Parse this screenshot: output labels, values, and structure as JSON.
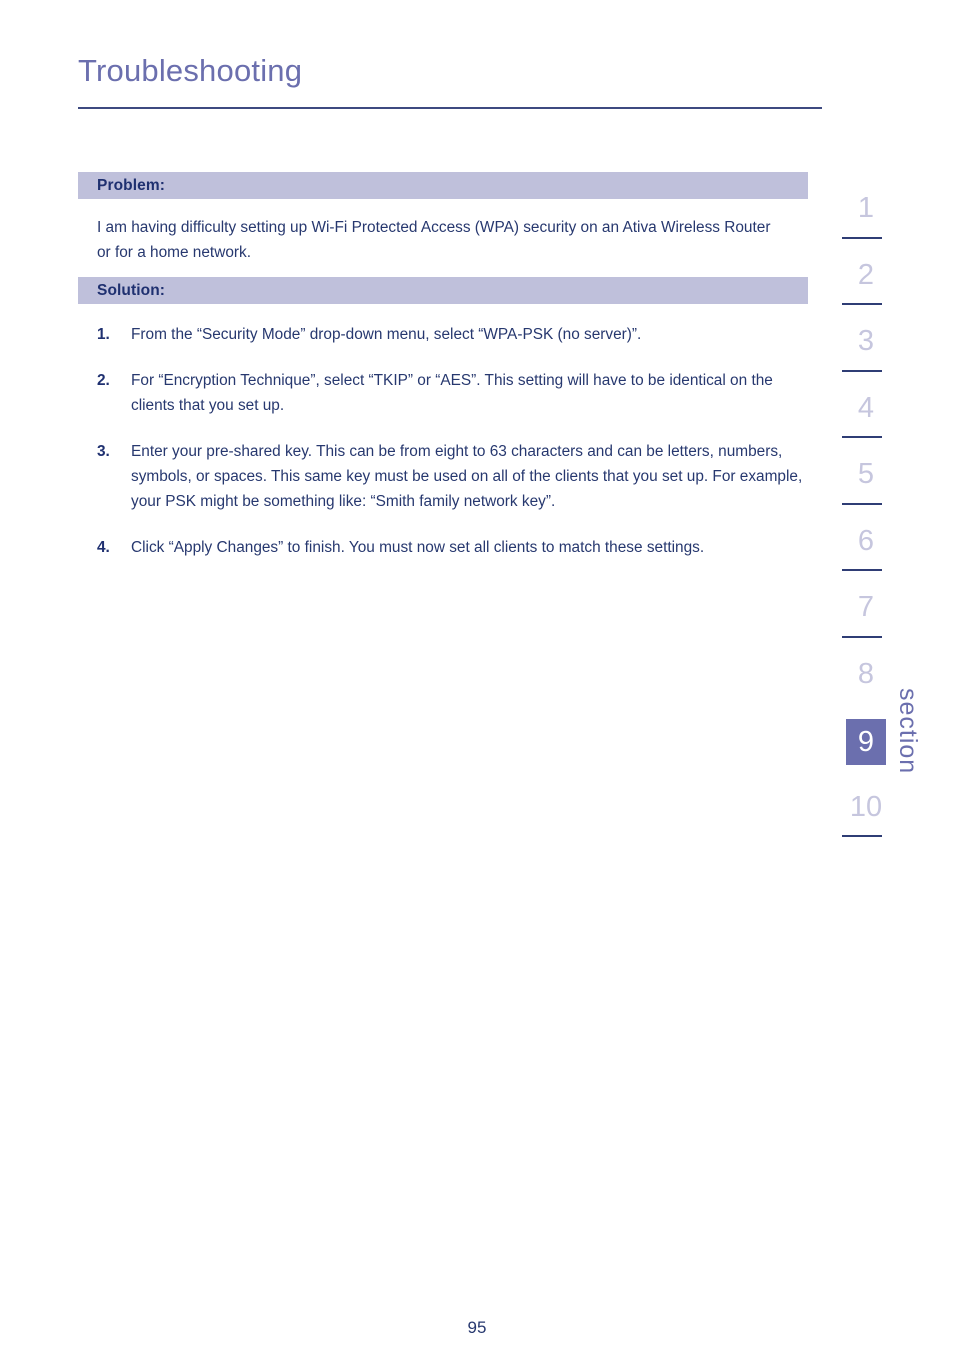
{
  "page": {
    "title": "Troubleshooting",
    "number": "95"
  },
  "colors": {
    "title": "#6b6fae",
    "band_background": "#bfc0db",
    "band_text": "#1f3070",
    "body_text": "#27386f",
    "rail_inactive": "#c6c6de",
    "rail_active_background": "#6b6fae",
    "rail_divider": "#2f3d75"
  },
  "problem": {
    "label": "Problem:",
    "text": "I am having difficulty setting up Wi-Fi Protected Access (WPA) security on an Ativa Wireless Router or for a home network."
  },
  "solution": {
    "label": "Solution:",
    "steps": [
      {
        "number": "1.",
        "text": "From the “Security Mode” drop-down menu, select “WPA-PSK (no server)”."
      },
      {
        "number": "2.",
        "text": "For “Encryption Technique”, select “TKIP” or “AES”. This setting will have to be identical on the clients that you set up."
      },
      {
        "number": "3.",
        "text": "Enter your pre-shared key. This can be from eight to 63 characters and can be letters, numbers, symbols, or spaces. This same key must be used on all of the clients that you set up. For example, your PSK might be something like: “Smith family network key”."
      },
      {
        "number": "4.",
        "text": "Click “Apply Changes” to finish. You must now set all clients to match these settings."
      }
    ]
  },
  "section_rail": {
    "word": "section",
    "active": "9",
    "items": [
      {
        "label": "1",
        "active": false,
        "divider": true
      },
      {
        "label": "2",
        "active": false,
        "divider": true
      },
      {
        "label": "3",
        "active": false,
        "divider": true
      },
      {
        "label": "4",
        "active": false,
        "divider": true
      },
      {
        "label": "5",
        "active": false,
        "divider": true
      },
      {
        "label": "6",
        "active": false,
        "divider": true
      },
      {
        "label": "7",
        "active": false,
        "divider": true
      },
      {
        "label": "8",
        "active": false,
        "divider": false
      },
      {
        "label": "9",
        "active": true,
        "divider": false
      },
      {
        "label": "10",
        "active": false,
        "divider": true
      }
    ]
  }
}
